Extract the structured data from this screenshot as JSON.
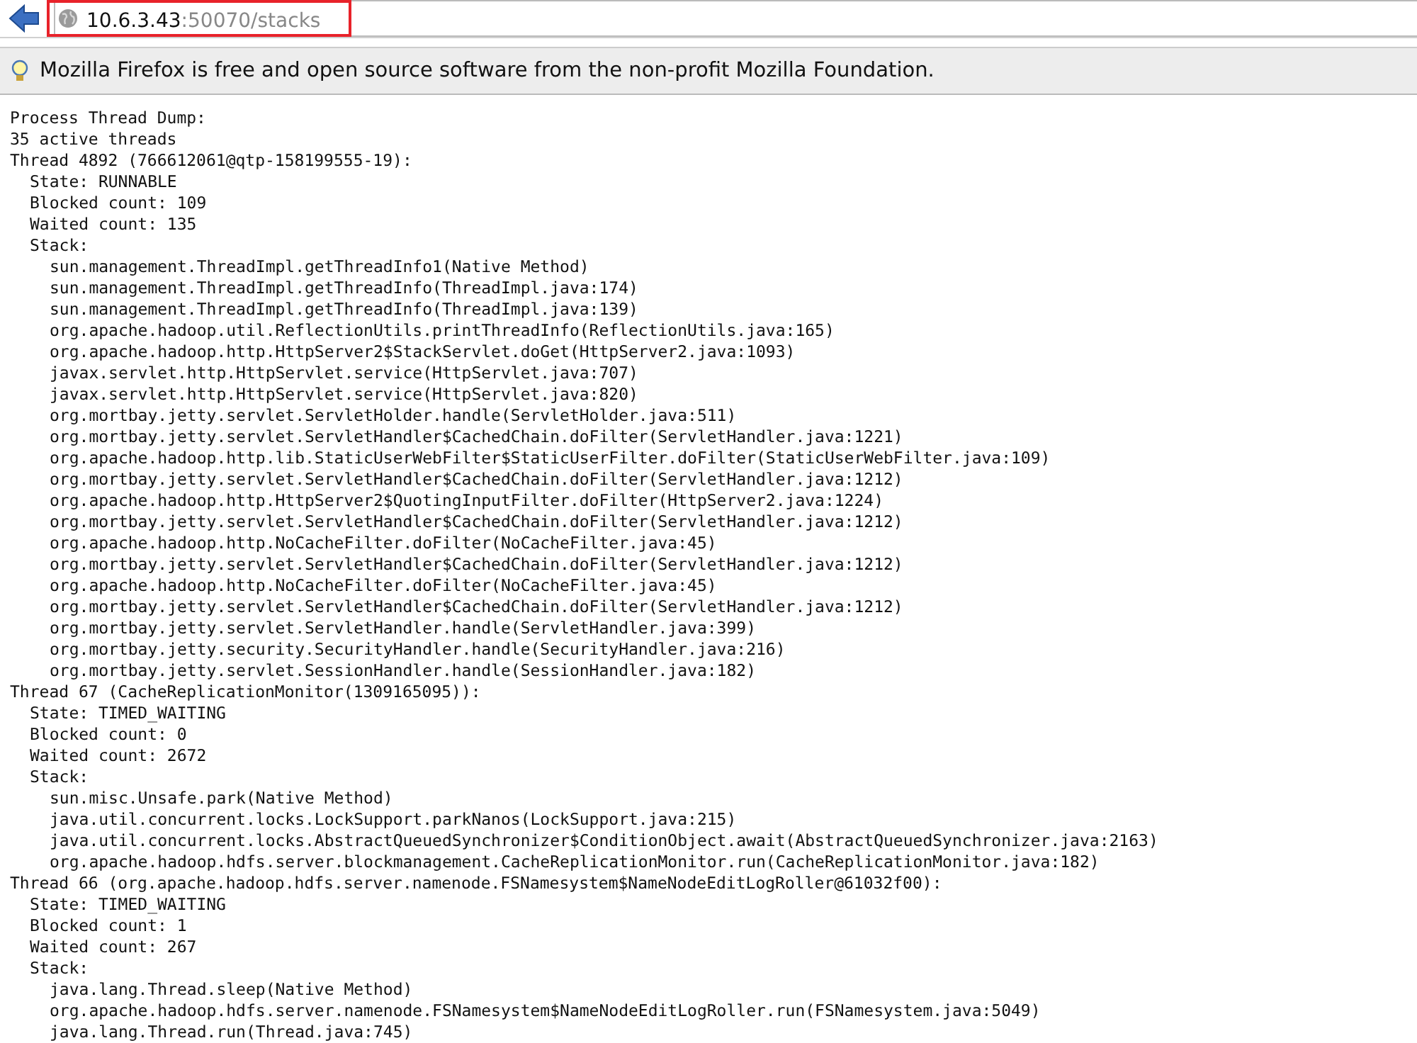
{
  "toolbar": {
    "url_host": "10.6.3.43",
    "url_path": ":50070/stacks"
  },
  "notification": {
    "text": "Mozilla Firefox is free and open source software from the non-profit Mozilla Foundation."
  },
  "dump": {
    "title": "Process Thread Dump:",
    "count": "35 active threads",
    "threads": [
      {
        "header": "Thread 4892 (766612061@qtp-158199555-19):",
        "state": "State: RUNNABLE",
        "blocked": "Blocked count: 109",
        "waited": "Waited count: 135",
        "stack_label": "Stack:",
        "frames": [
          "sun.management.ThreadImpl.getThreadInfo1(Native Method)",
          "sun.management.ThreadImpl.getThreadInfo(ThreadImpl.java:174)",
          "sun.management.ThreadImpl.getThreadInfo(ThreadImpl.java:139)",
          "org.apache.hadoop.util.ReflectionUtils.printThreadInfo(ReflectionUtils.java:165)",
          "org.apache.hadoop.http.HttpServer2$StackServlet.doGet(HttpServer2.java:1093)",
          "javax.servlet.http.HttpServlet.service(HttpServlet.java:707)",
          "javax.servlet.http.HttpServlet.service(HttpServlet.java:820)",
          "org.mortbay.jetty.servlet.ServletHolder.handle(ServletHolder.java:511)",
          "org.mortbay.jetty.servlet.ServletHandler$CachedChain.doFilter(ServletHandler.java:1221)",
          "org.apache.hadoop.http.lib.StaticUserWebFilter$StaticUserFilter.doFilter(StaticUserWebFilter.java:109)",
          "org.mortbay.jetty.servlet.ServletHandler$CachedChain.doFilter(ServletHandler.java:1212)",
          "org.apache.hadoop.http.HttpServer2$QuotingInputFilter.doFilter(HttpServer2.java:1224)",
          "org.mortbay.jetty.servlet.ServletHandler$CachedChain.doFilter(ServletHandler.java:1212)",
          "org.apache.hadoop.http.NoCacheFilter.doFilter(NoCacheFilter.java:45)",
          "org.mortbay.jetty.servlet.ServletHandler$CachedChain.doFilter(ServletHandler.java:1212)",
          "org.apache.hadoop.http.NoCacheFilter.doFilter(NoCacheFilter.java:45)",
          "org.mortbay.jetty.servlet.ServletHandler$CachedChain.doFilter(ServletHandler.java:1212)",
          "org.mortbay.jetty.servlet.ServletHandler.handle(ServletHandler.java:399)",
          "org.mortbay.jetty.security.SecurityHandler.handle(SecurityHandler.java:216)",
          "org.mortbay.jetty.servlet.SessionHandler.handle(SessionHandler.java:182)"
        ]
      },
      {
        "header": "Thread 67 (CacheReplicationMonitor(1309165095)):",
        "state": "State: TIMED_WAITING",
        "blocked": "Blocked count: 0",
        "waited": "Waited count: 2672",
        "stack_label": "Stack:",
        "frames": [
          "sun.misc.Unsafe.park(Native Method)",
          "java.util.concurrent.locks.LockSupport.parkNanos(LockSupport.java:215)",
          "java.util.concurrent.locks.AbstractQueuedSynchronizer$ConditionObject.await(AbstractQueuedSynchronizer.java:2163)",
          "org.apache.hadoop.hdfs.server.blockmanagement.CacheReplicationMonitor.run(CacheReplicationMonitor.java:182)"
        ]
      },
      {
        "header": "Thread 66 (org.apache.hadoop.hdfs.server.namenode.FSNamesystem$NameNodeEditLogRoller@61032f00):",
        "state": "State: TIMED_WAITING",
        "blocked": "Blocked count: 1",
        "waited": "Waited count: 267",
        "stack_label": "Stack:",
        "frames": [
          "java.lang.Thread.sleep(Native Method)",
          "org.apache.hadoop.hdfs.server.namenode.FSNamesystem$NameNodeEditLogRoller.run(FSNamesystem.java:5049)",
          "java.lang.Thread.run(Thread.java:745)"
        ]
      }
    ]
  }
}
